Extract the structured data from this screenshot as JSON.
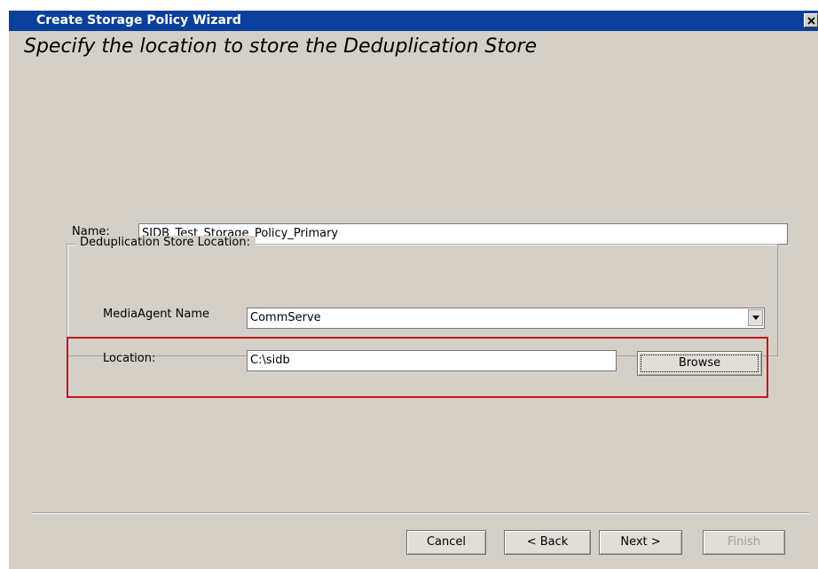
{
  "window": {
    "title": "Create Storage Policy Wizard",
    "close_symbol": "×"
  },
  "page": {
    "heading": "Specify the location to store the Deduplication Store"
  },
  "form": {
    "name_label": "Name:",
    "name_value": "SIDB_Test_Storage_Policy_Primary",
    "group_title": "Deduplication Store Location:",
    "media_agent_label": "MediaAgent Name",
    "media_agent_value": "CommServe",
    "location_label": "Location:",
    "location_value": "C:\\sidb",
    "browse_label": "Browse"
  },
  "footer": {
    "cancel_label": "Cancel",
    "back_label": "< Back",
    "next_label": "Next >",
    "finish_label": "Finish"
  },
  "colors": {
    "titlebar": "#0a3f9c",
    "dialog_bg": "#d4d0c8",
    "highlight": "#c0171c"
  }
}
